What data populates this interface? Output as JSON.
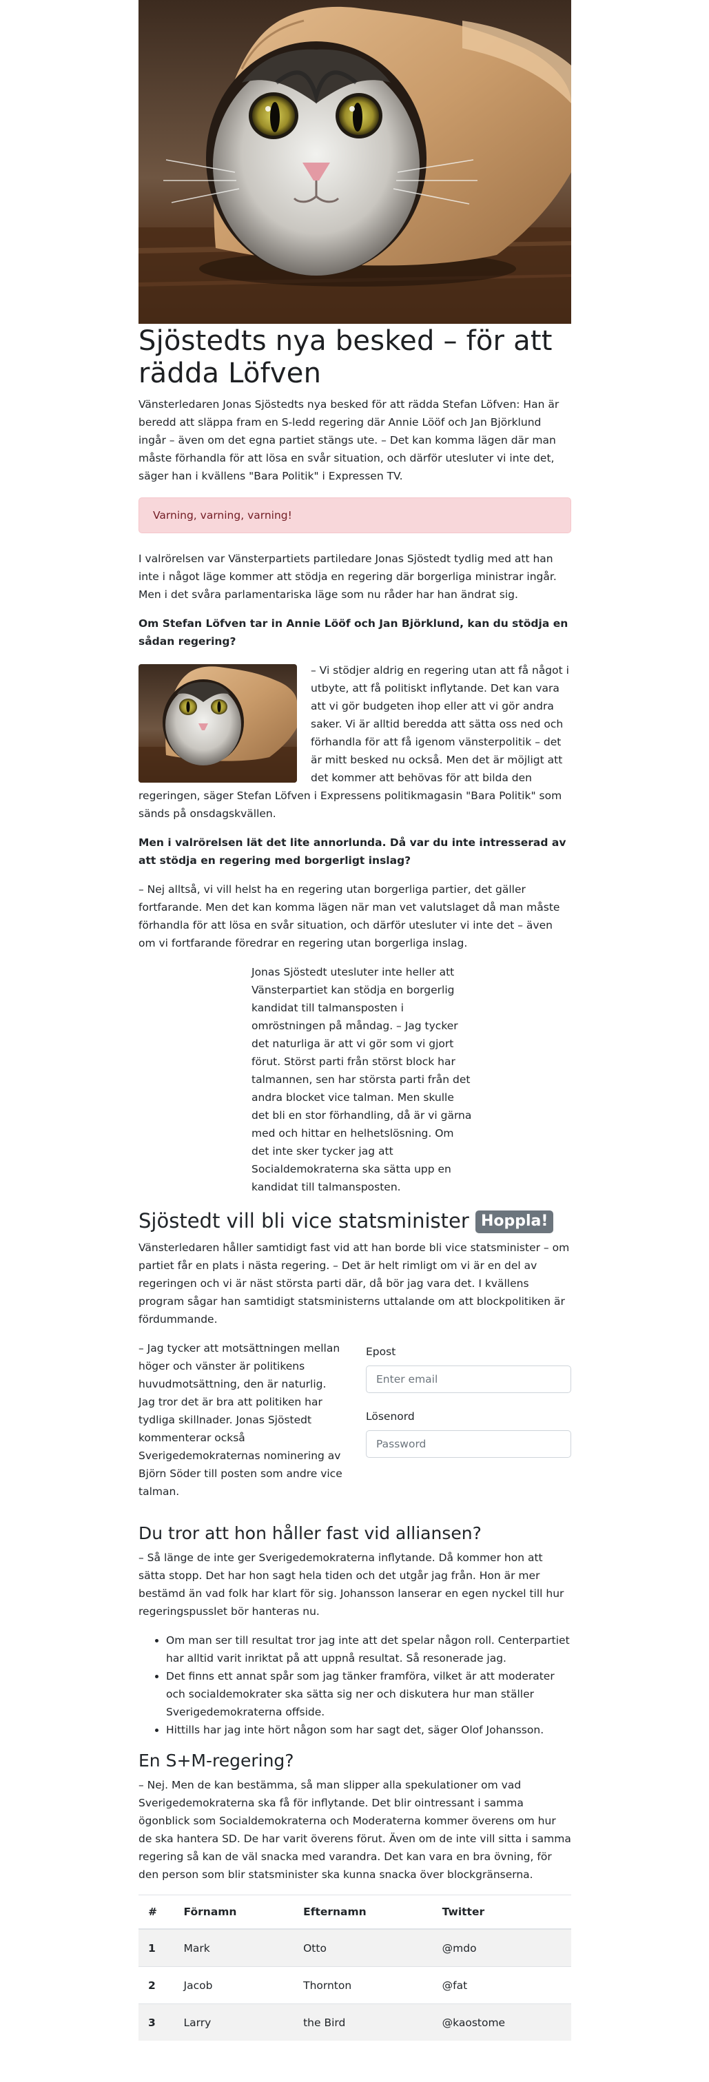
{
  "article": {
    "title": "Sjöstedts nya besked – för att rädda Löfven",
    "lead": "Vänsterledaren Jonas Sjöstedts nya besked för att rädda Stefan Löfven: Han är beredd att släppa fram en S-ledd regering där Annie Lööf och Jan Björklund ingår – även om det egna partiet stängs ute. – Det kan komma lägen där man måste förhandla för att lösa en svår situation, och därför utesluter vi inte det, säger han i kvällens \"Bara Politik\" i Expressen TV.",
    "alert": "Varning, varning, varning!",
    "p1": "I valrörelsen var Vänsterpartiets partiledare Jonas Sjöstedt tydlig med att han inte i något läge kommer att stödja en regering där borgerliga ministrar ingår. Men i det svåra parlamentariska läge som nu råder har han ändrat sig.",
    "q1": "Om Stefan Löfven tar in Annie Lööf och Jan Björklund, kan du stödja en sådan regering?",
    "a1": "– Vi stödjer aldrig en regering utan att få något i utbyte, att få politiskt inflytande. Det kan vara att vi gör budgeten ihop eller att vi gör andra saker. Vi är alltid beredda att sätta oss ned och förhandla för att få igenom vänsterpolitik – det är mitt besked nu också. Men det är möjligt att det kommer att behövas för att bilda den regeringen, säger Stefan Löfven i Expressens politikmagasin \"Bara Politik\" som sänds på onsdagskvällen.",
    "q2": "Men i valrörelsen lät det lite annorlunda. Då var du inte intresserad av att stödja en regering med borgerligt inslag?",
    "a2": "– Nej alltså, vi vill helst ha en regering utan borgerliga partier, det gäller fortfarande. Men det kan komma lägen när man vet valutslaget då man måste förhandla för att lösa en svår situation, och därför utesluter vi inte det – även om vi fortfarande föredrar en regering utan borgerliga inslag.",
    "quote": "Jonas Sjöstedt utesluter inte heller att Vänsterpartiet kan stödja en borgerlig kandidat till talmansposten i omröstningen på måndag. – Jag tycker det naturliga är att vi gör som vi gjort förut. Störst parti från störst block har talmannen, sen har största parti från det andra blocket vice talman. Men skulle det bli en stor förhandling, då är vi gärna med och hittar en helhetslösning. Om det inte sker tycker jag att Socialdemokraterna ska sätta upp en kandidat till talmansposten.",
    "h2": "Sjöstedt vill bli vice statsminister",
    "badge": "Hoppla!",
    "p2": "Vänsterledaren håller samtidigt fast vid att han borde bli vice statsminister – om partiet får en plats i nästa regering. – Det är helt rimligt om vi är en del av regeringen och vi är näst största parti där, då bör jag vara det. I kvällens program sågar han samtidigt statsministerns uttalande om att blockpolitiken är fördummande.",
    "p3": "– Jag tycker att motsättningen mellan höger och vänster är politikens huvudmotsättning, den är naturlig. Jag tror det är bra att politiken har tydliga skillnader. Jonas Sjöstedt kommenterar också Sverigedemokraternas nominering av Björn Söder till posten som andre vice talman.",
    "h3a": "Du tror att hon håller fast vid alliansen?",
    "p4": "– Så länge de inte ger Sverigedemokraterna inflytande. Då kommer hon att sätta stopp. Det har hon sagt hela tiden och det utgår jag från. Hon är mer bestämd än vad folk har klart för sig. Johansson lanserar en egen nyckel till hur regeringspusslet bör hanteras nu.",
    "bullets": [
      "Om man ser till resultat tror jag inte att det spelar någon roll. Centerpartiet har alltid varit inriktat på att uppnå resultat. Så resonerade jag.",
      "Det finns ett annat spår som jag tänker framföra, vilket är att moderater och socialdemokrater ska sätta sig ner och diskutera hur man ställer Sverigedemokraterna offside.",
      "Hittills har jag inte hört någon som har sagt det, säger Olof Johansson."
    ],
    "h3b": "En S+M-regering?",
    "p5": "– Nej. Men de kan bestämma, så man slipper alla spekulationer om vad Sverigedemokraterna ska få för inflytande. Det blir ointressant i samma ögonblick som Socialdemokraterna och Moderaterna kommer överens om hur de ska hantera SD. De har varit överens förut. Även om de inte vill sitta i samma regering så kan de väl snacka med varandra. Det kan vara en bra övning, för den person som blir statsminister ska kunna snacka över blockgränserna."
  },
  "form": {
    "email_label": "Epost",
    "email_placeholder": "Enter email",
    "password_label": "Lösenord",
    "password_placeholder": "Password"
  },
  "table": {
    "headers": [
      "#",
      "Förnamn",
      "Efternamn",
      "Twitter"
    ],
    "rows": [
      [
        "1",
        "Mark",
        "Otto",
        "@mdo"
      ],
      [
        "2",
        "Jacob",
        "Thornton",
        "@fat"
      ],
      [
        "3",
        "Larry",
        "the Bird",
        "@kaostome"
      ]
    ]
  }
}
